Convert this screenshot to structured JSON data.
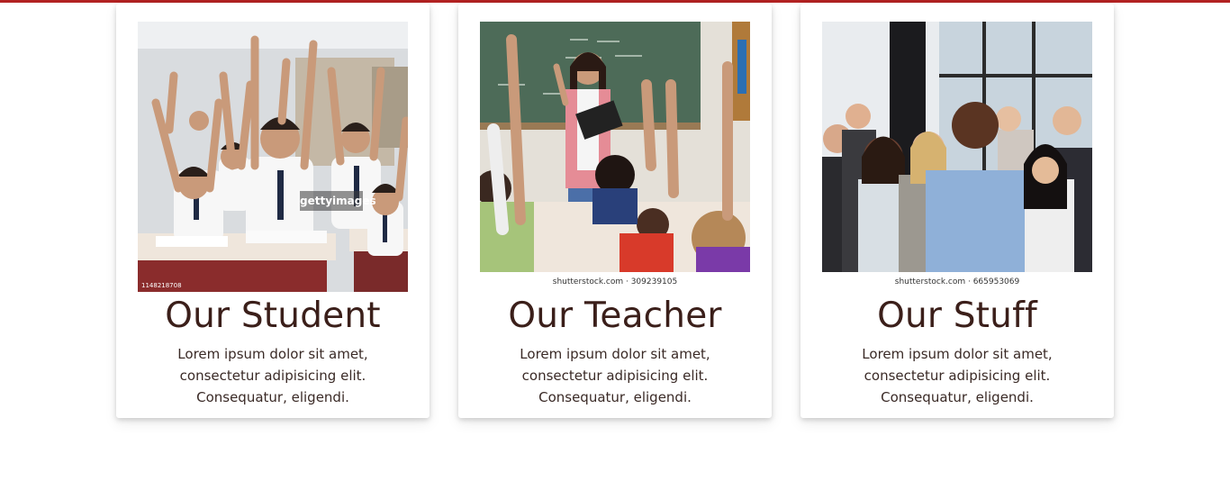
{
  "colors": {
    "accent_bar": "#b22222",
    "title": "#3b1f1a",
    "body_text": "#3a2a26"
  },
  "cards": [
    {
      "title": "Our Student",
      "text": "Lorem ipsum dolor sit amet, consectetur adipisicing elit. Consequatur, eligendi.",
      "image_alt": "Students raising hands in classroom",
      "watermark_brand": "gettyimages",
      "watermark_id": "1148218708"
    },
    {
      "title": "Our Teacher",
      "text": "Lorem ipsum dolor sit amet, consectetur adipisicing elit. Consequatur, eligendi.",
      "image_alt": "Teacher in front of blackboard with students",
      "watermark_caption": "shutterstock.com · 309239105"
    },
    {
      "title": "Our Stuff",
      "text": "Lorem ipsum dolor sit amet, consectetur adipisicing elit. Consequatur, eligendi.",
      "image_alt": "Group of staff members posing",
      "watermark_caption": "shutterstock.com · 665953069"
    }
  ]
}
